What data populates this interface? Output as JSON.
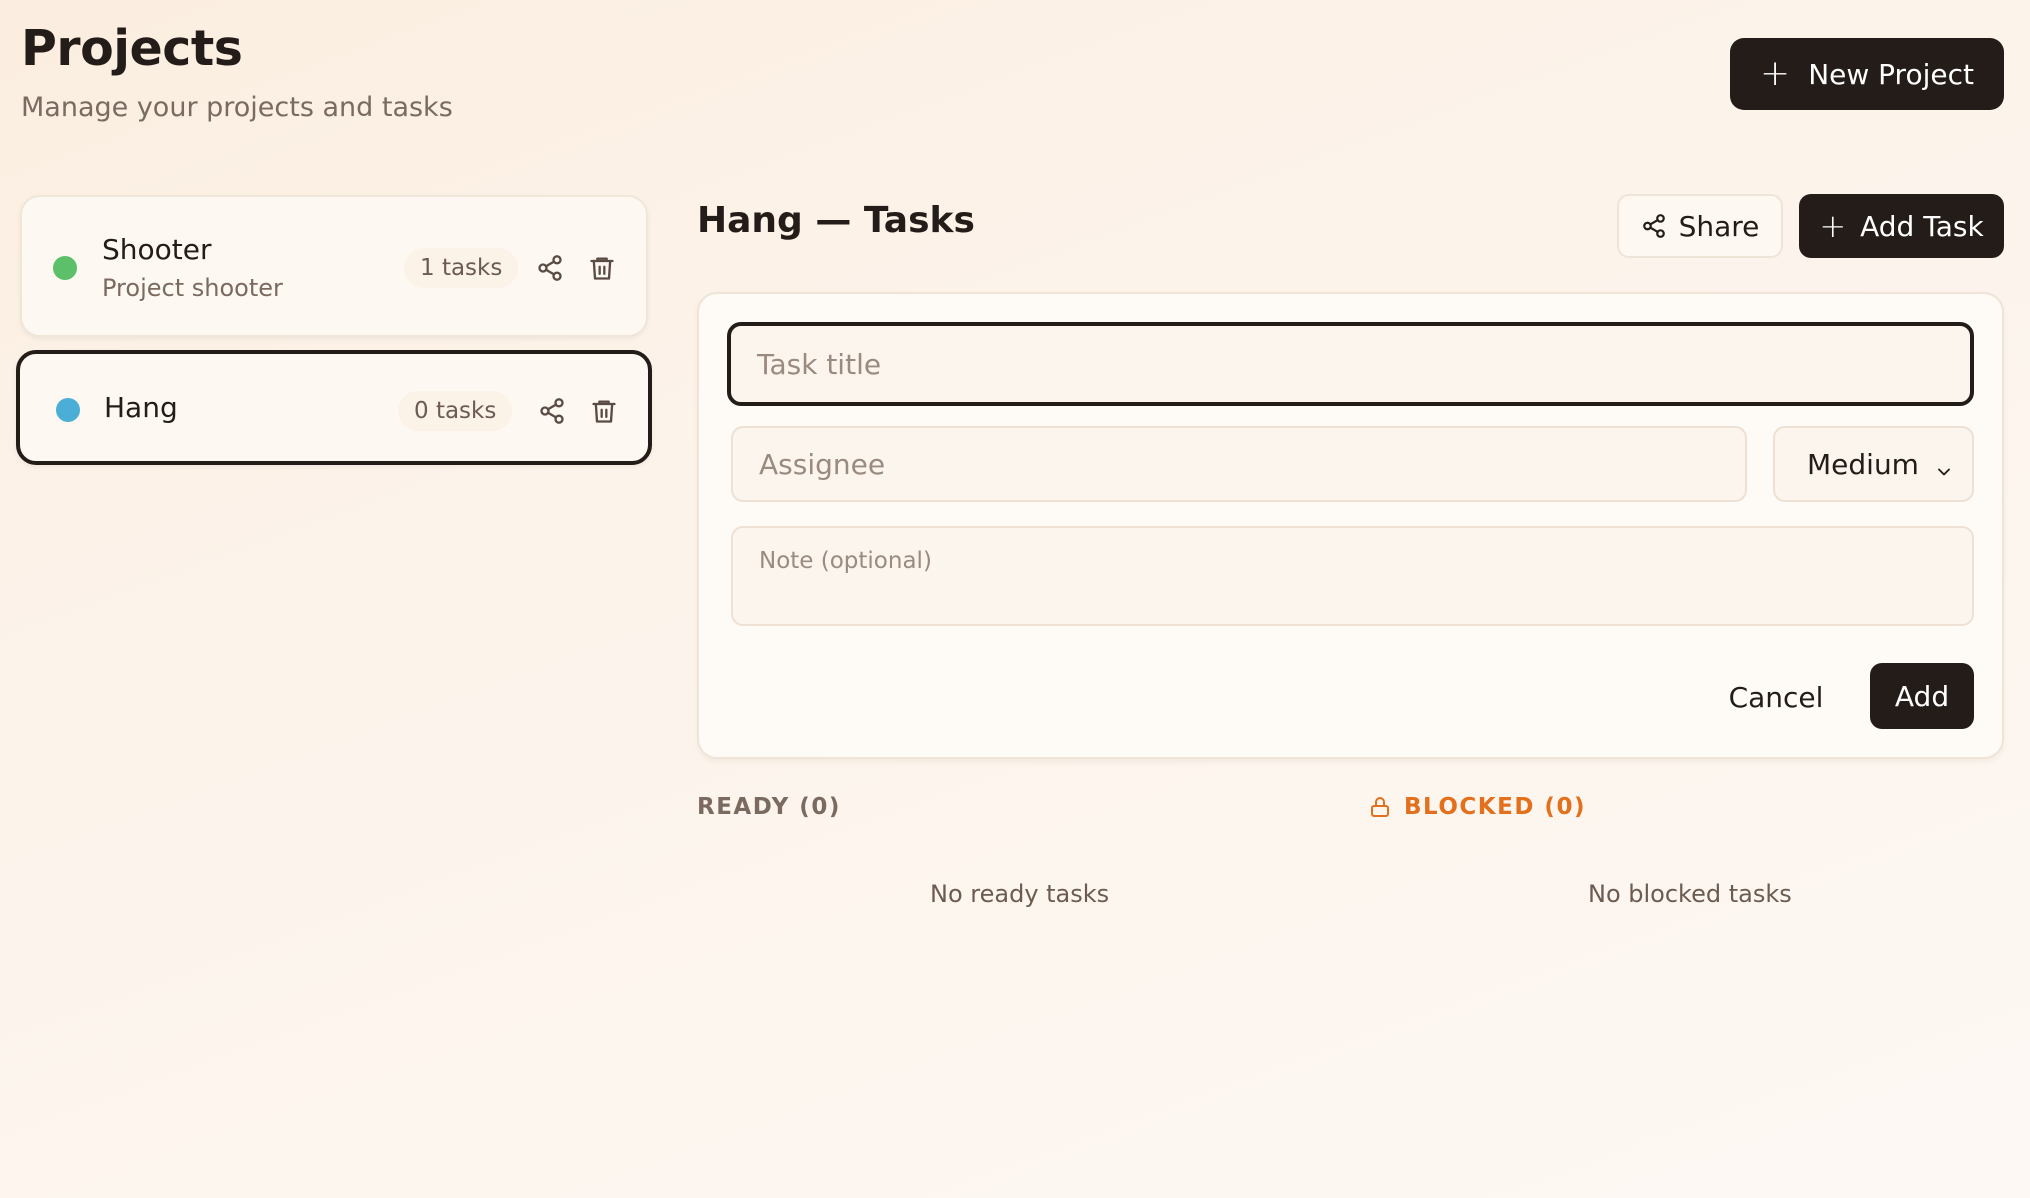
{
  "header": {
    "title": "Projects",
    "subtitle": "Manage your projects and tasks",
    "new_project_label": "New Project"
  },
  "projects": [
    {
      "name": "Shooter",
      "description": "Project shooter",
      "task_count": "1 tasks",
      "color": "#5cbf6a",
      "selected": false
    },
    {
      "name": "Hang",
      "description": "",
      "task_count": "0 tasks",
      "color": "#4aaed6",
      "selected": true
    }
  ],
  "panel": {
    "title": "Hang — Tasks",
    "share_label": "Share",
    "add_task_label": "Add Task"
  },
  "task_form": {
    "title_placeholder": "Task title",
    "assignee_placeholder": "Assignee",
    "priority_value": "Medium",
    "note_placeholder": "Note (optional)",
    "cancel_label": "Cancel",
    "add_label": "Add"
  },
  "columns": {
    "ready": {
      "label": "READY (0)",
      "empty": "No ready tasks"
    },
    "blocked": {
      "label": "BLOCKED (0)",
      "empty": "No blocked tasks",
      "color": "#e2701d"
    }
  },
  "icons": {
    "plus": "plus-icon",
    "share": "share-icon",
    "trash": "trash-icon",
    "lock": "lock-icon",
    "chevron": "chevron-down-icon"
  }
}
